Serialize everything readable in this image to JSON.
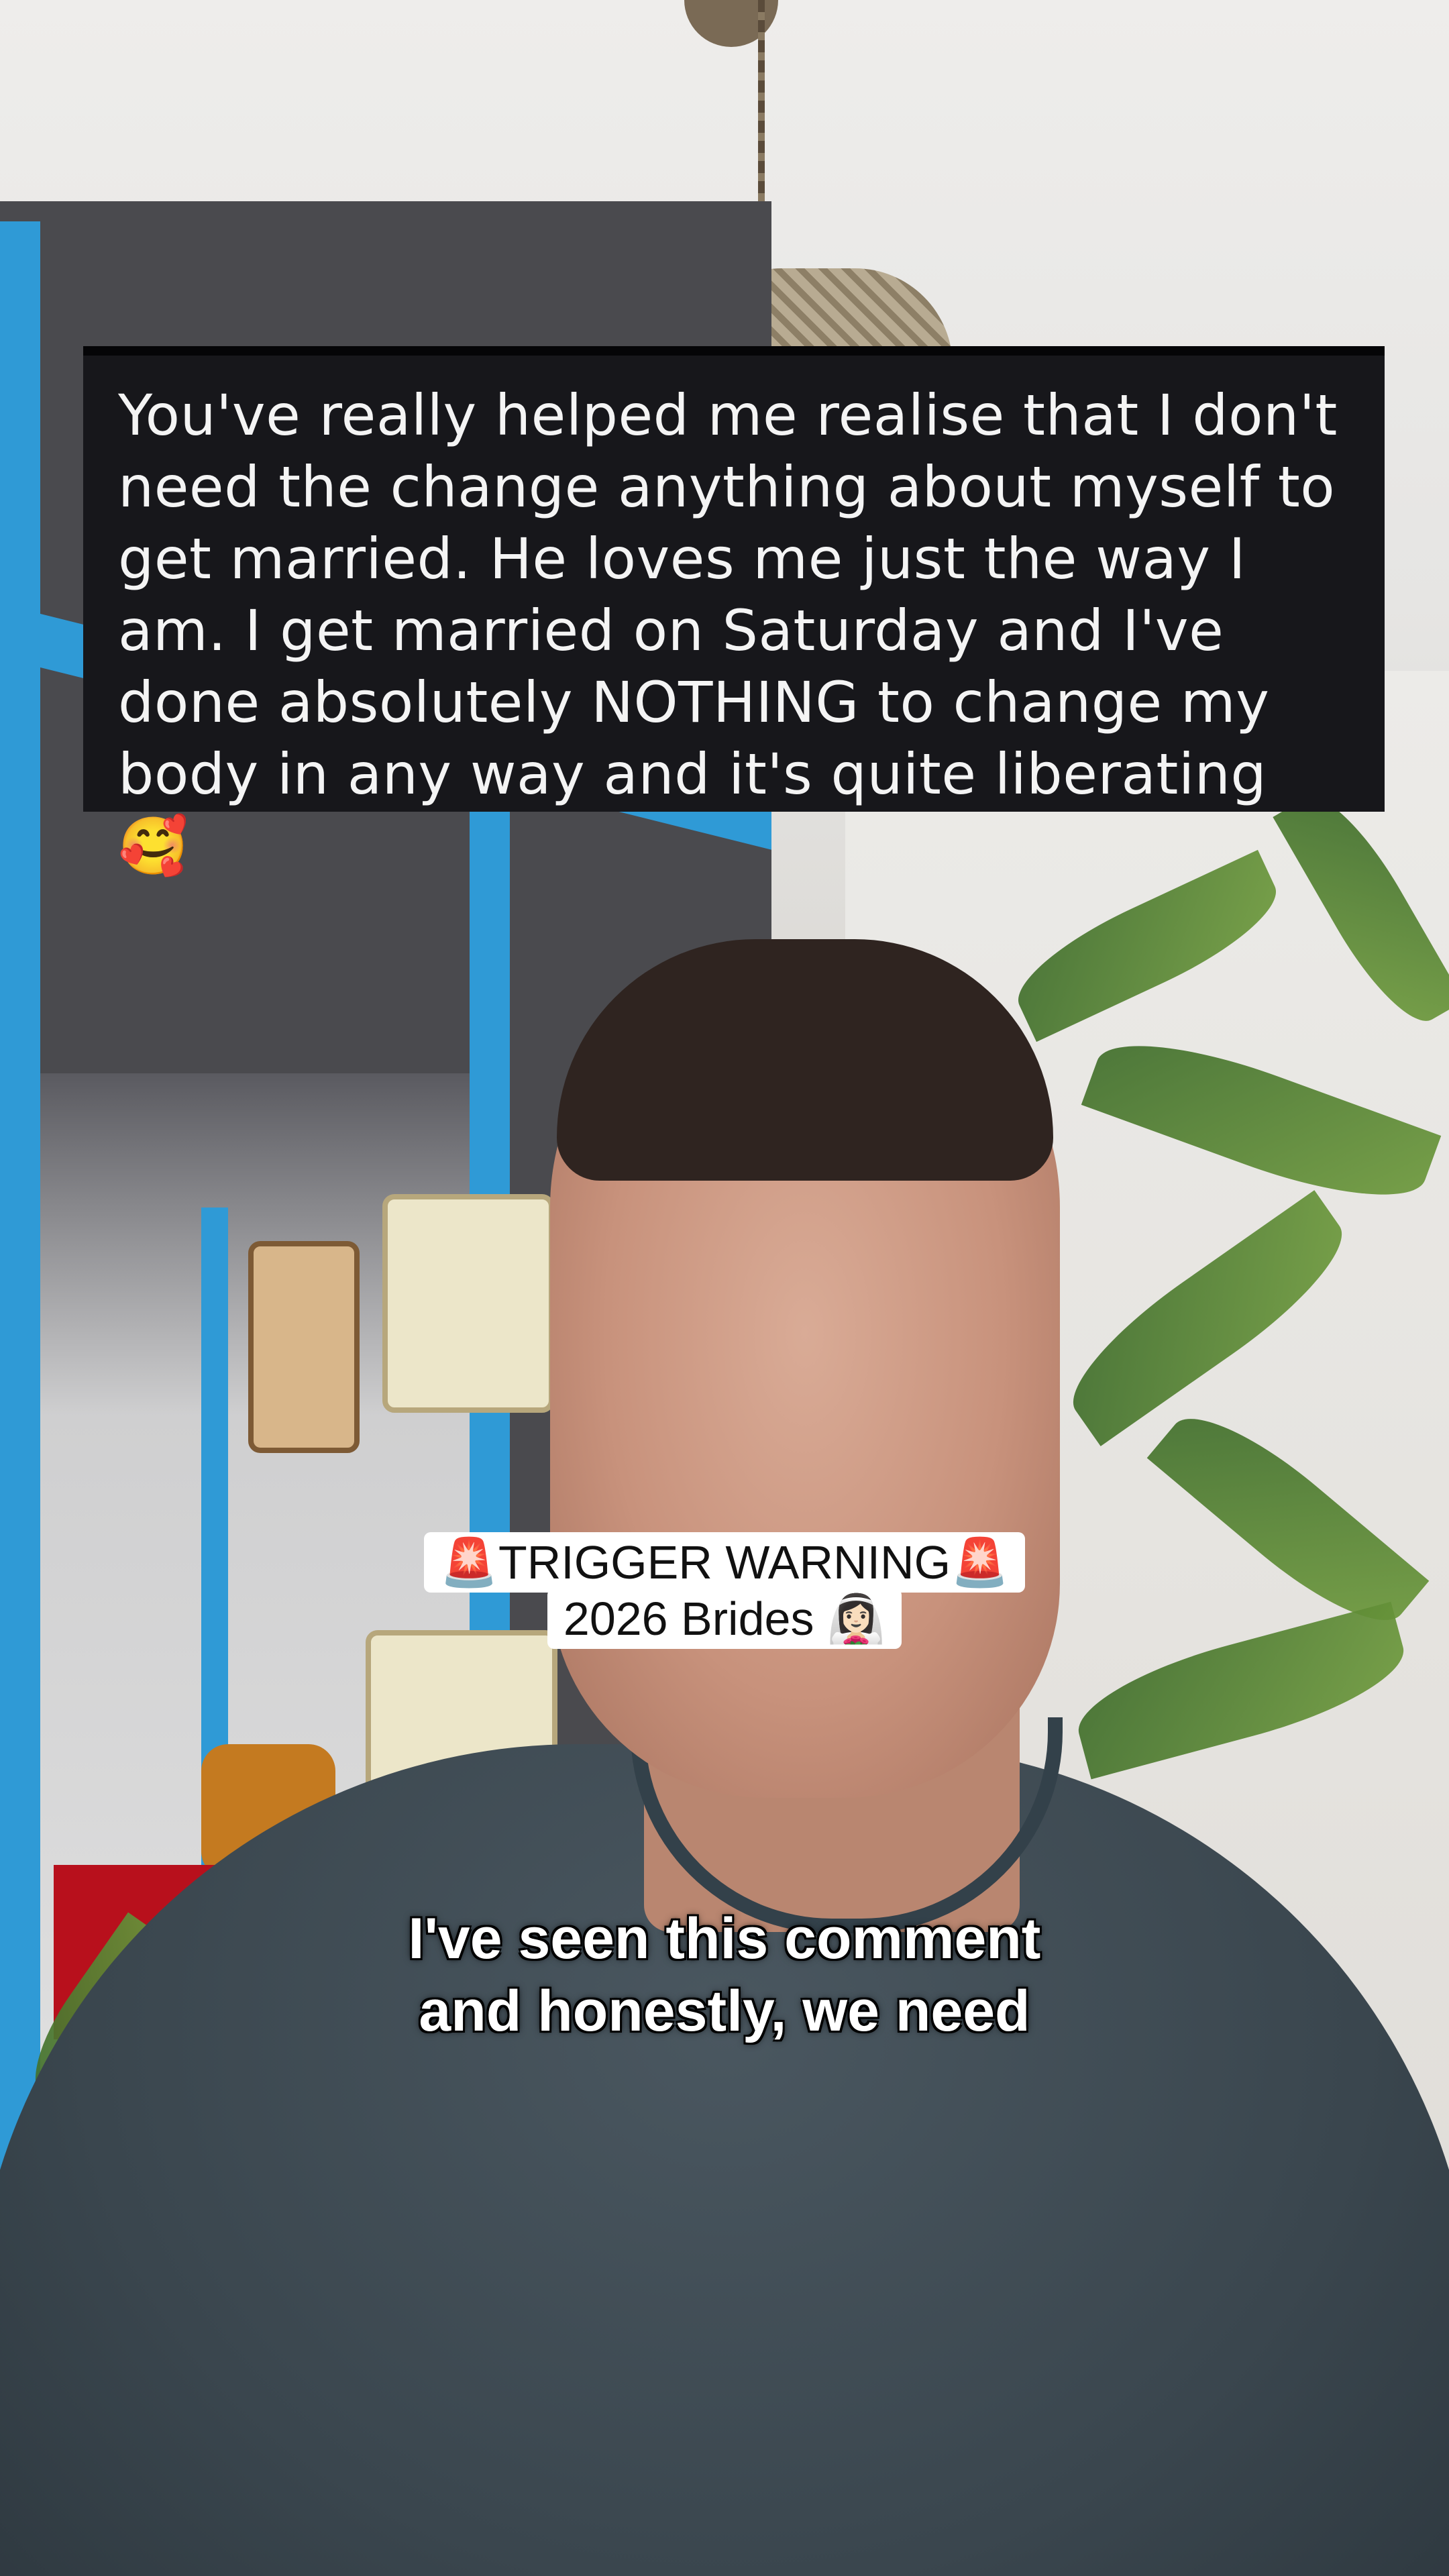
{
  "comment": {
    "text": "You've really helped me realise that I don't need the change anything about myself to get married. He loves me just the way I am. I get married on Saturday and I've done absolutely NOTHING to change my body in any way and it's quite liberating 🥰"
  },
  "overlay": {
    "line1": "🚨TRIGGER WARNING🚨",
    "line2": "2026 Brides 👰🏻‍♀️"
  },
  "caption": {
    "text": "I've seen this comment\nand honestly, we need"
  },
  "colors": {
    "comment_bg": "#17171b",
    "cabinet_blue": "#2f9ad6",
    "shirt": "#3a464e"
  }
}
